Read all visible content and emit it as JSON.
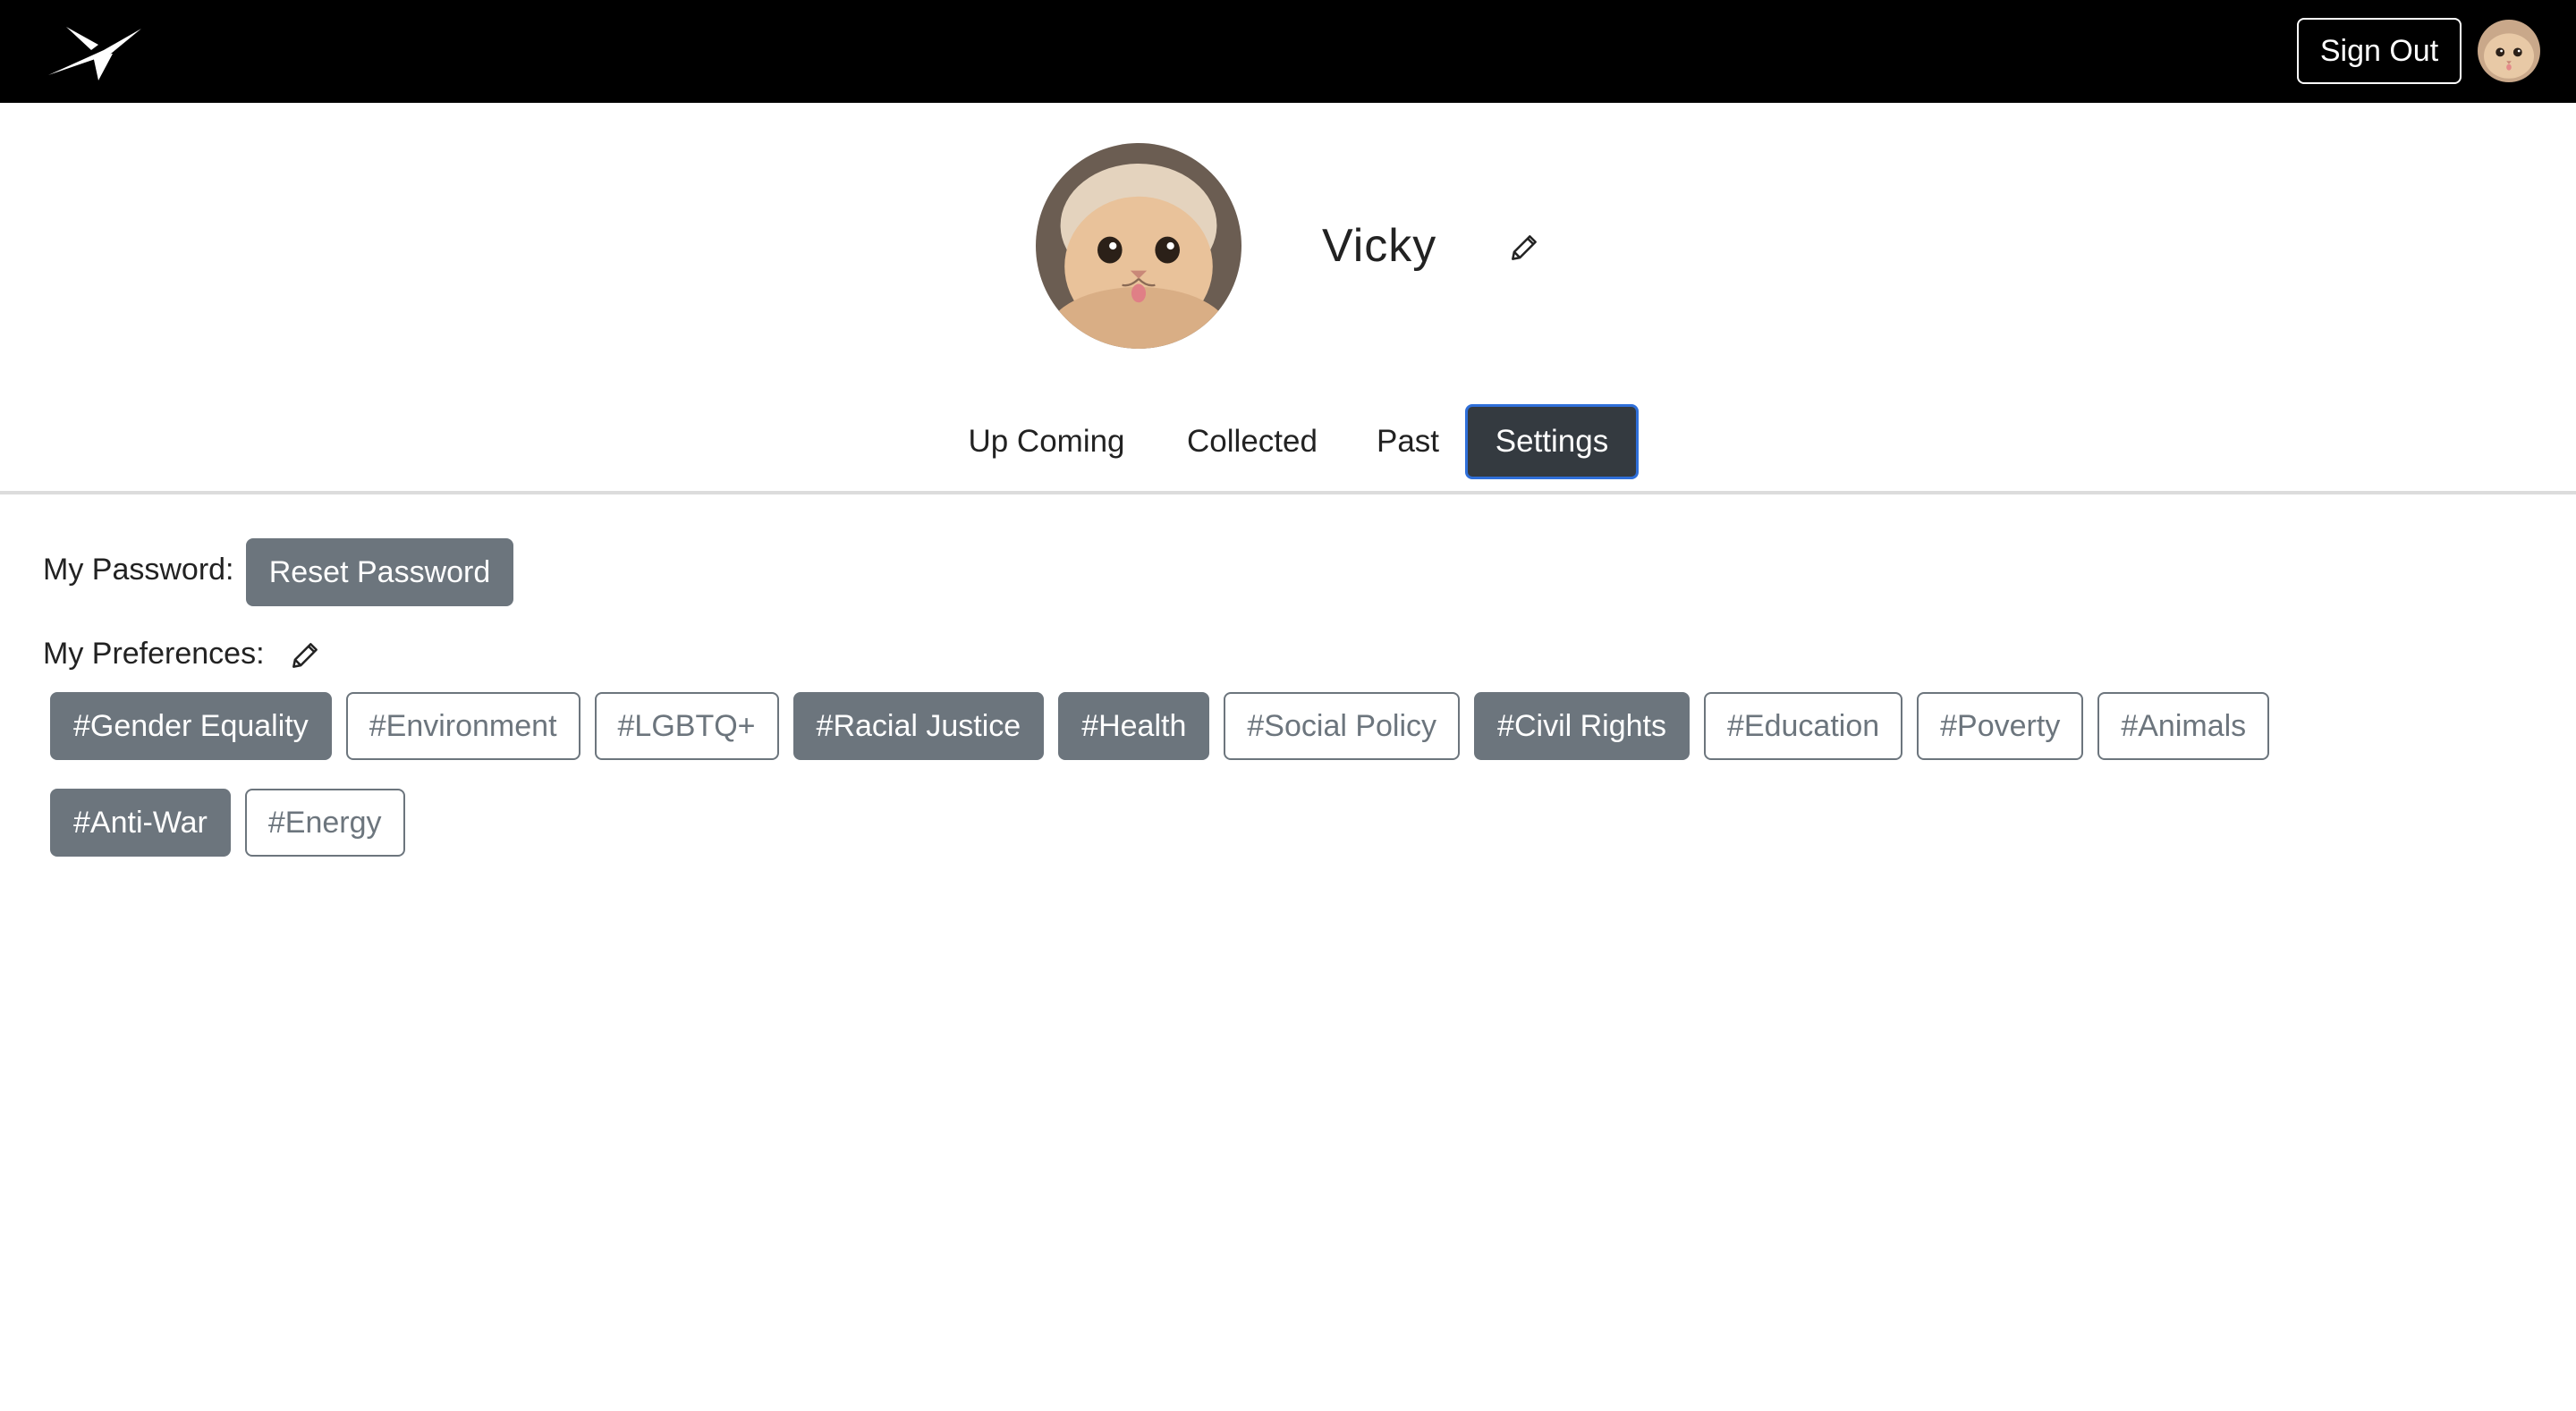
{
  "navbar": {
    "logo_icon": "paper-plane-logo",
    "sign_out_label": "Sign Out",
    "avatar_icon": "cat-avatar"
  },
  "profile": {
    "name": "Vicky",
    "avatar_icon": "cat-avatar",
    "edit_icon": "pencil-icon"
  },
  "tabs": [
    {
      "label": "Up Coming",
      "active": false
    },
    {
      "label": "Collected",
      "active": false
    },
    {
      "label": "Past",
      "active": false
    },
    {
      "label": "Settings",
      "active": true
    }
  ],
  "settings": {
    "password_label": "My Password:",
    "reset_password_label": "Reset Password",
    "preferences_label": "My Preferences:",
    "preferences_edit_icon": "pencil-icon",
    "tags": [
      {
        "label": "#Gender Equality",
        "selected": true
      },
      {
        "label": "#Environment",
        "selected": false
      },
      {
        "label": "#LGBTQ+",
        "selected": false
      },
      {
        "label": "#Racial Justice",
        "selected": true
      },
      {
        "label": "#Health",
        "selected": true
      },
      {
        "label": "#Social Policy",
        "selected": false
      },
      {
        "label": "#Civil Rights",
        "selected": true
      },
      {
        "label": "#Education",
        "selected": false
      },
      {
        "label": "#Poverty",
        "selected": false
      },
      {
        "label": "#Animals",
        "selected": false
      },
      {
        "label": "#Anti-War",
        "selected": true
      },
      {
        "label": "#Energy",
        "selected": false
      }
    ]
  },
  "colors": {
    "navbar_bg": "#000000",
    "active_tab_bg": "#343a40",
    "active_tab_border": "#2f6fd9",
    "tag_gray": "#6c757d"
  }
}
